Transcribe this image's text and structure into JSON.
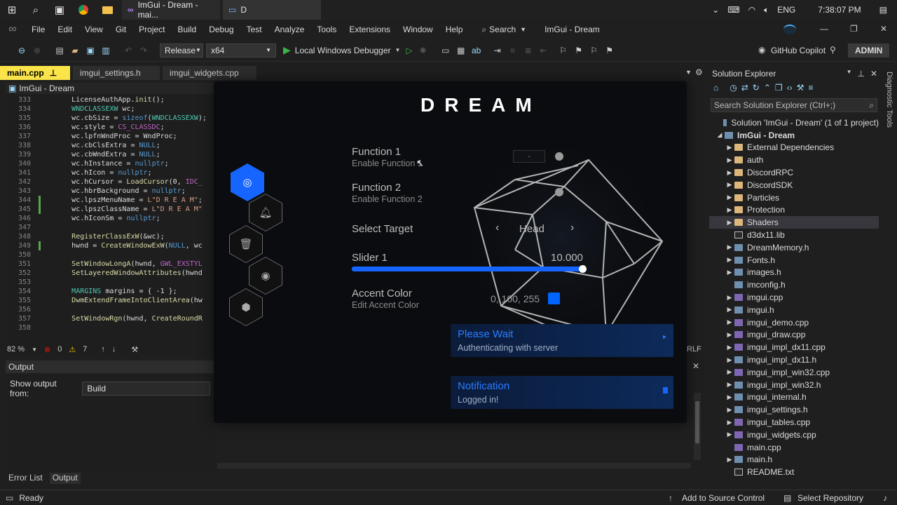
{
  "taskbar": {
    "tab1_label": "ImGui - Dream - mai...",
    "tab2_label": "D",
    "language": "ENG",
    "clock": "7:38:07 PM"
  },
  "menubar": {
    "items": [
      "File",
      "Edit",
      "View",
      "Git",
      "Project",
      "Build",
      "Debug",
      "Test",
      "Analyze",
      "Tools",
      "Extensions",
      "Window",
      "Help"
    ],
    "search_label": "Search",
    "solution_title": "ImGui - Dream",
    "admin_label": "ADMIN"
  },
  "toolbar": {
    "config": "Release",
    "platform": "x64",
    "debugger": "Local Windows Debugger",
    "copilot": "GitHub Copilot"
  },
  "tabs": [
    "main.cpp",
    "imgui_settings.h",
    "imgui_widgets.cpp"
  ],
  "editor": {
    "breadcrumb": "ImGui - Dream",
    "lines": [
      {
        "n": "333",
        "text": "        LicenseAuthApp.init();"
      },
      {
        "n": "334",
        "text": "        WNDCLASSEXW wc;"
      },
      {
        "n": "335",
        "text": "        wc.cbSize = sizeof(WNDCLASSEXW);"
      },
      {
        "n": "336",
        "text": "        wc.style = CS_CLASSDC;"
      },
      {
        "n": "337",
        "text": "        wc.lpfnWndProc = WndProc;"
      },
      {
        "n": "338",
        "text": "        wc.cbClsExtra = NULL;"
      },
      {
        "n": "339",
        "text": "        wc.cbWndExtra = NULL;"
      },
      {
        "n": "340",
        "text": "        wc.hInstance = nullptr;"
      },
      {
        "n": "341",
        "text": "        wc.hIcon = nullptr;"
      },
      {
        "n": "342",
        "text": "        wc.hCursor = LoadCursor(0, IDC_"
      },
      {
        "n": "343",
        "text": "        wc.hbrBackground = nullptr;"
      },
      {
        "n": "344",
        "text": "        wc.lpszMenuName = L\"D R E A M\";"
      },
      {
        "n": "345",
        "text": "        wc.lpszClassName = L\"D R E A M\""
      },
      {
        "n": "346",
        "text": "        wc.hIconSm = nullptr;"
      },
      {
        "n": "347",
        "text": ""
      },
      {
        "n": "348",
        "text": "        RegisterClassExW(&wc);"
      },
      {
        "n": "349",
        "text": "        hwnd = CreateWindowExW(NULL, wc"
      },
      {
        "n": "350",
        "text": ""
      },
      {
        "n": "351",
        "text": "        SetWindowLongA(hwnd, GWL_EXSTYL"
      },
      {
        "n": "352",
        "text": "        SetLayeredWindowAttributes(hwnd"
      },
      {
        "n": "353",
        "text": ""
      },
      {
        "n": "354",
        "text": "        MARGINS margins = { -1 };"
      },
      {
        "n": "355",
        "text": "        DwmExtendFrameIntoClientArea(hw"
      },
      {
        "n": "356",
        "text": ""
      },
      {
        "n": "357",
        "text": "        SetWindowRgn(hwnd, CreateRoundR"
      },
      {
        "n": "358",
        "text": ""
      }
    ],
    "zoom": "82 %",
    "errors": "0",
    "warnings": "7",
    "line_ending": "RLF"
  },
  "output": {
    "title": "Output",
    "show_from_label": "Show output from:",
    "show_from_value": "Build"
  },
  "bottom_tabs": [
    "Error List",
    "Output"
  ],
  "statusbar": {
    "ready": "Ready",
    "source_control": "Add to Source Control",
    "repo": "Select Repository"
  },
  "solution_explorer": {
    "title": "Solution Explorer",
    "search_placeholder": "Search Solution Explorer (Ctrl+;)",
    "items": [
      {
        "label": "Solution 'ImGui - Dream' (1 of 1 project)",
        "type": "sln",
        "indent": 0,
        "arrow": ""
      },
      {
        "label": "ImGui - Dream",
        "type": "proj",
        "indent": 1,
        "arrow": "◢"
      },
      {
        "label": "External Dependencies",
        "type": "folder",
        "indent": 2,
        "arrow": "▶"
      },
      {
        "label": "auth",
        "type": "folder",
        "indent": 2,
        "arrow": "▶"
      },
      {
        "label": "DiscordRPC",
        "type": "folder",
        "indent": 2,
        "arrow": "▶"
      },
      {
        "label": "DiscordSDK",
        "type": "folder",
        "indent": 2,
        "arrow": "▶"
      },
      {
        "label": "Particles",
        "type": "folder",
        "indent": 2,
        "arrow": "▶"
      },
      {
        "label": "Protection",
        "type": "folder",
        "indent": 2,
        "arrow": "▶"
      },
      {
        "label": "Shaders",
        "type": "folder",
        "indent": 2,
        "arrow": "▶"
      },
      {
        "label": "d3dx11.lib",
        "type": "file",
        "indent": 2,
        "arrow": ""
      },
      {
        "label": "DreamMemory.h",
        "type": "h",
        "indent": 2,
        "arrow": "▶"
      },
      {
        "label": "Fonts.h",
        "type": "h",
        "indent": 2,
        "arrow": "▶"
      },
      {
        "label": "images.h",
        "type": "h",
        "indent": 2,
        "arrow": "▶"
      },
      {
        "label": "imconfig.h",
        "type": "h",
        "indent": 2,
        "arrow": ""
      },
      {
        "label": "imgui.cpp",
        "type": "cpp",
        "indent": 2,
        "arrow": "▶"
      },
      {
        "label": "imgui.h",
        "type": "h",
        "indent": 2,
        "arrow": "▶"
      },
      {
        "label": "imgui_demo.cpp",
        "type": "cpp",
        "indent": 2,
        "arrow": "▶"
      },
      {
        "label": "imgui_draw.cpp",
        "type": "cpp",
        "indent": 2,
        "arrow": "▶"
      },
      {
        "label": "imgui_impl_dx11.cpp",
        "type": "cpp",
        "indent": 2,
        "arrow": "▶"
      },
      {
        "label": "imgui_impl_dx11.h",
        "type": "h",
        "indent": 2,
        "arrow": "▶"
      },
      {
        "label": "imgui_impl_win32.cpp",
        "type": "cpp",
        "indent": 2,
        "arrow": "▶"
      },
      {
        "label": "imgui_impl_win32.h",
        "type": "h",
        "indent": 2,
        "arrow": "▶"
      },
      {
        "label": "imgui_internal.h",
        "type": "h",
        "indent": 2,
        "arrow": "▶"
      },
      {
        "label": "imgui_settings.h",
        "type": "h",
        "indent": 2,
        "arrow": "▶"
      },
      {
        "label": "imgui_tables.cpp",
        "type": "cpp",
        "indent": 2,
        "arrow": "▶"
      },
      {
        "label": "imgui_widgets.cpp",
        "type": "cpp",
        "indent": 2,
        "arrow": "▶"
      },
      {
        "label": "main.cpp",
        "type": "cpp",
        "indent": 2,
        "arrow": ""
      },
      {
        "label": "main.h",
        "type": "h",
        "indent": 2,
        "arrow": "▶"
      },
      {
        "label": "README.txt",
        "type": "file",
        "indent": 2,
        "arrow": ""
      }
    ],
    "selected": "Shaders"
  },
  "diagnostic_tools": "Diagnostic Tools",
  "dream": {
    "logo": "DREAM",
    "function1_title": "Function 1",
    "function1_sub": "Enable Function 1",
    "function2_title": "Function 2",
    "function2_sub": "Enable Function 2",
    "keybind_label": "-",
    "target_label": "Select Target",
    "target_value": "Head",
    "slider_label": "Slider 1",
    "slider_value": "10.000",
    "slider_fraction": 1.0,
    "accent_title": "Accent Color",
    "accent_sub": "Edit Accent Color",
    "accent_value": "0, 100, 255",
    "accent_color": "#0064ff",
    "wait_title": "Please Wait",
    "wait_sub": "Authenticating with server",
    "notif_title": "Notification",
    "notif_sub": "Logged in!"
  }
}
